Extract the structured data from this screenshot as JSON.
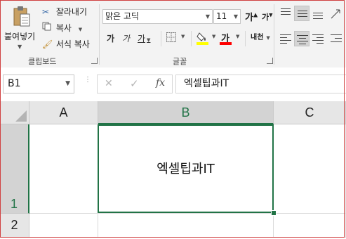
{
  "clipboard": {
    "paste_label": "붙여넣기",
    "cut_label": "잘라내기",
    "copy_label": "복사",
    "format_painter_label": "서식 복사",
    "group_label": "클립보드"
  },
  "font": {
    "family_value": "맑은 고딕",
    "size_value": "11",
    "grow_glyph": "가",
    "shrink_glyph": "가",
    "bold_glyph": "가",
    "italic_glyph": "가",
    "underline_glyph": "가",
    "font_color_glyph": "가",
    "phonetic_glyph": "내천",
    "group_label": "글꼴",
    "fill_color": "#ffff00",
    "font_color": "#ff0000"
  },
  "formula_bar": {
    "name_box_value": "B1",
    "cancel_glyph": "✕",
    "enter_glyph": "✓",
    "fx_glyph": "fx",
    "formula_value": "엑셀팁과IT"
  },
  "grid": {
    "columns": [
      "A",
      "B",
      "C"
    ],
    "rows": [
      "1",
      "2"
    ],
    "active_cell": "B1",
    "cell_b1_value": "엑셀팁과IT",
    "accent_color": "#217346"
  }
}
